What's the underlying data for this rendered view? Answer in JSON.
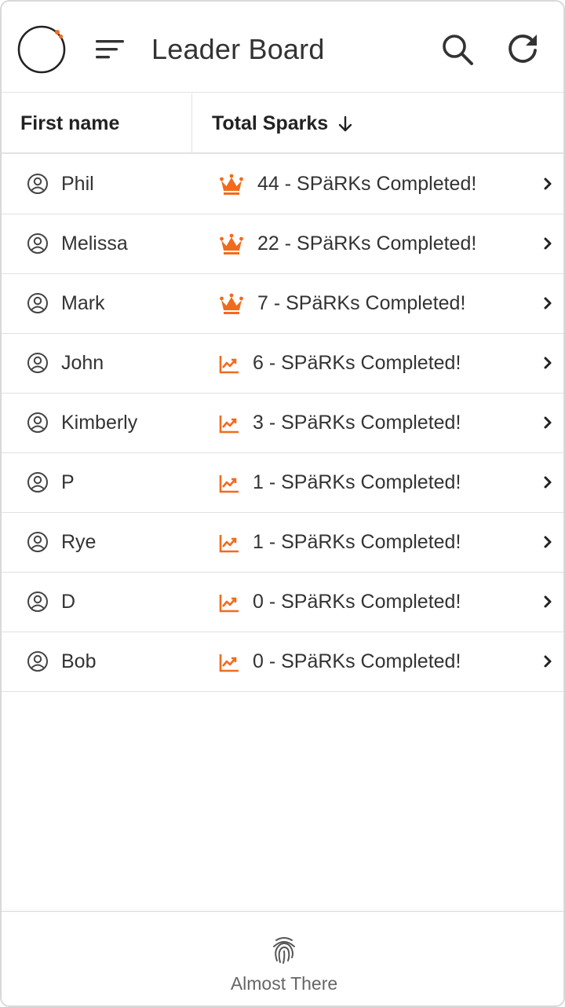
{
  "header": {
    "title": "Leader Board",
    "logo_icon": "loading-ring-logo",
    "menu_icon": "sort-lines-icon",
    "search_icon": "search-icon",
    "refresh_icon": "refresh-icon"
  },
  "table": {
    "columns": [
      {
        "label": "First name"
      },
      {
        "label": "Total Sparks",
        "sort": "descending"
      }
    ],
    "rows": [
      {
        "name": "Phil",
        "icon": "crown",
        "status": "44 - SPäRKs Completed!"
      },
      {
        "name": "Melissa",
        "icon": "crown",
        "status": "22 - SPäRKs Completed!"
      },
      {
        "name": "Mark",
        "icon": "crown",
        "status": "7 - SPäRKs Completed!"
      },
      {
        "name": "John",
        "icon": "trend",
        "status": "6 - SPäRKs Completed!"
      },
      {
        "name": "Kimberly",
        "icon": "trend",
        "status": "3 - SPäRKs Completed!"
      },
      {
        "name": "P",
        "icon": "trend",
        "status": "1 - SPäRKs Completed!"
      },
      {
        "name": "Rye",
        "icon": "trend",
        "status": "1 - SPäRKs Completed!"
      },
      {
        "name": "D",
        "icon": "trend",
        "status": "0 - SPäRKs Completed!"
      },
      {
        "name": "Bob",
        "icon": "trend",
        "status": "0 - SPäRKs Completed!"
      }
    ]
  },
  "bottom_nav": {
    "label": "Almost There",
    "icon": "fingerprint-icon"
  },
  "colors": {
    "accent": "#f26b1d",
    "text": "#333333",
    "divider": "#e0e0e0"
  }
}
